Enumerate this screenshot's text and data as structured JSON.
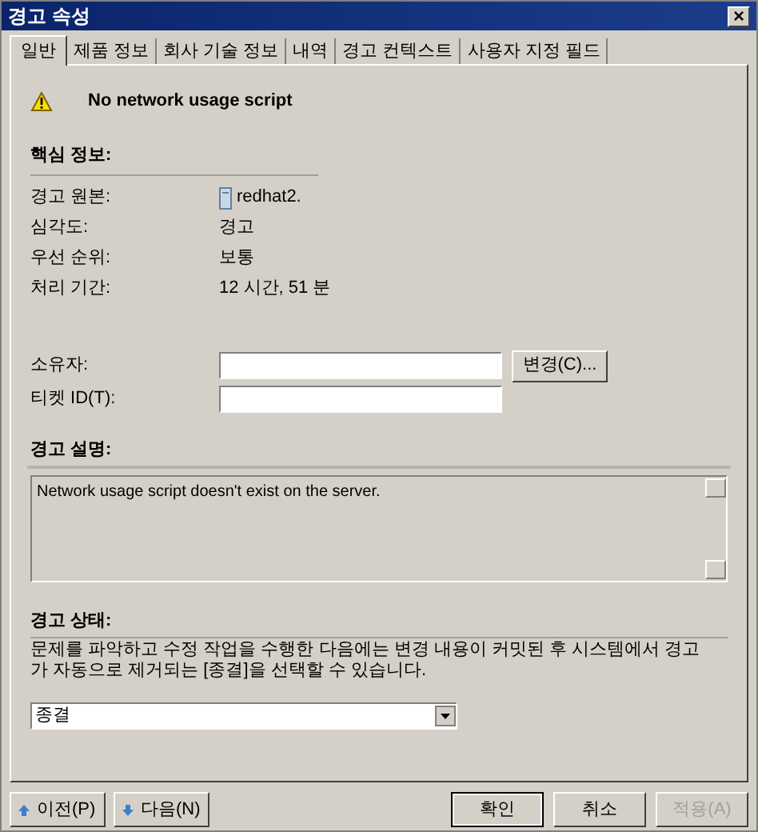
{
  "window": {
    "title": "경고 속성",
    "close": "×"
  },
  "tabs": [
    {
      "label": "일반",
      "selected": true
    },
    {
      "label": "제품 정보",
      "selected": false
    },
    {
      "label": "회사 기술 정보",
      "selected": false
    },
    {
      "label": "내역",
      "selected": false
    },
    {
      "label": "경고 컨텍스트",
      "selected": false
    },
    {
      "label": "사용자 지정 필드",
      "selected": false
    }
  ],
  "alert": {
    "name": "No network usage script"
  },
  "key_info": {
    "heading": "핵심 정보:",
    "rows": [
      {
        "label": "경고 원본:",
        "value": "redhat2.",
        "kind": "computer"
      },
      {
        "label": "심각도:",
        "value": "경고",
        "kind": "text"
      },
      {
        "label": "우선 순위:",
        "value": "보통",
        "kind": "text"
      },
      {
        "label": "처리 기간:",
        "value": "12 시간, 51 분",
        "kind": "text"
      }
    ]
  },
  "owner": {
    "label": "소유자:",
    "button": "변경(C)..."
  },
  "ticket": {
    "label": "티켓 ID(T):"
  },
  "description": {
    "heading": "경고 설명:",
    "text": "Network usage script doesn't exist on the server."
  },
  "status": {
    "heading": "경고 상태:",
    "help": "문제를 파악하고 수정 작업을 수행한 다음에는 변경 내용이 커밋된 후 시스템에서 경고가 자동으로 제거되는 [종결]을 선택할 수 있습니다.",
    "value": "종결"
  },
  "nav_buttons": [
    {
      "label": "이전(P)",
      "kind": "up"
    },
    {
      "label": "다음(N)",
      "kind": "down"
    }
  ],
  "buttons": [
    {
      "label": "확인",
      "disabled": false,
      "default": true
    },
    {
      "label": "취소",
      "disabled": false,
      "default": false
    },
    {
      "label": "적용(A)",
      "disabled": true,
      "default": false
    }
  ]
}
